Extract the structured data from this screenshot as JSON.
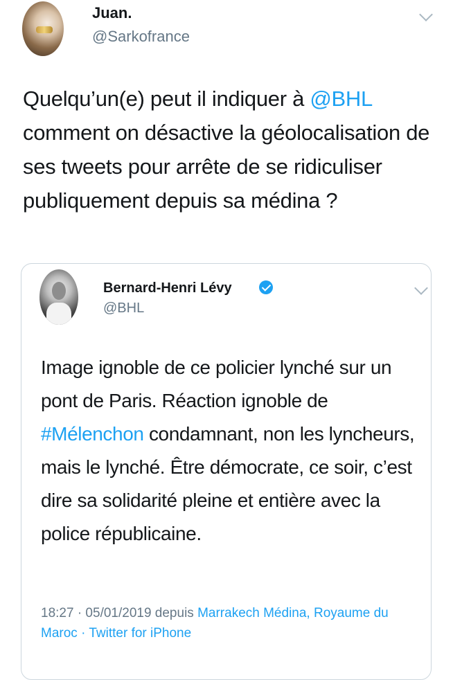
{
  "tweet": {
    "display_name": "Juan.",
    "handle": "@Sarkofrance",
    "text_before_mention": "Quelqu’un(e) peut il indiquer à ",
    "mention": "@BHL",
    "text_after_mention": " comment on désactive la géolocalisation de ses tweets pour arrête de se ridiculiser publiquement depuis sa médina ?"
  },
  "quoted": {
    "display_name": "Bernard-Henri Lévy",
    "handle": "@BHL",
    "text_before_hashtag": "Image ignoble de ce policier lynché sur un pont de Paris. Réaction ignoble de ",
    "hashtag": "#Mélenchon",
    "text_after_hashtag": " condamnant, non les lyncheurs, mais le lynché. Être démocrate, ce soir, c’est dire sa solidarité pleine et entière avec la police républicaine.",
    "timestamp": "18:27 · 05/01/2019 depuis ",
    "location": "Marrakech Médina, Royaume du Maroc",
    "separator": " · ",
    "client": "Twitter for iPhone"
  },
  "icons": {
    "chevron": "chevron-down-icon",
    "verified": "verified-badge-icon"
  },
  "colors": {
    "link": "#1da1f2",
    "secondary": "#657786",
    "border": "#ccd6dd"
  }
}
